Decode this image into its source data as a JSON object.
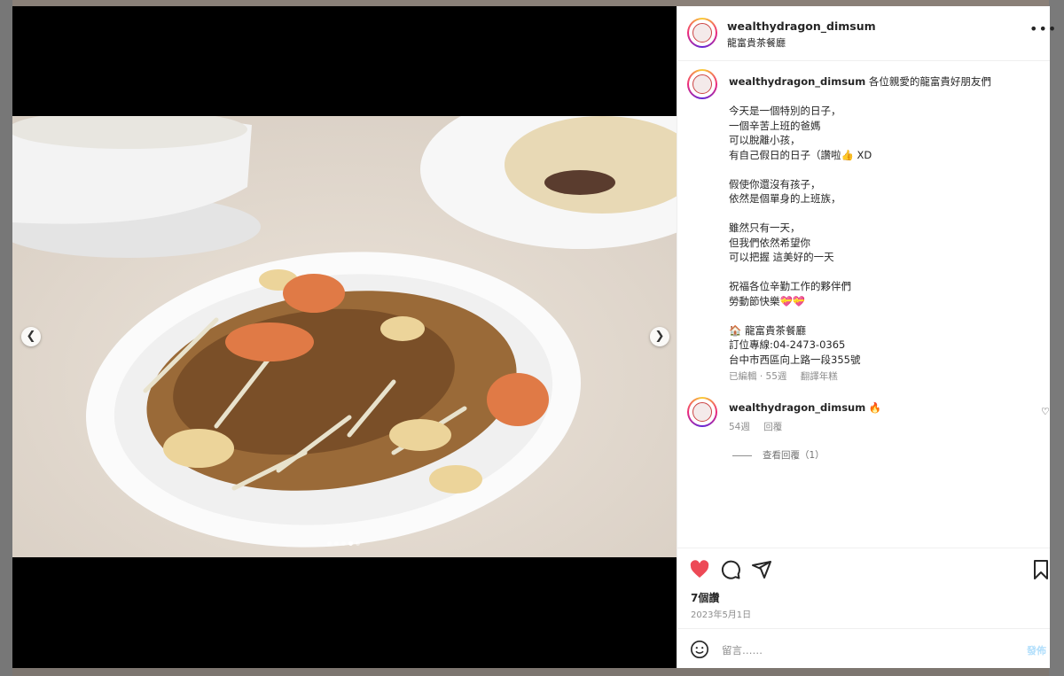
{
  "post": {
    "username": "wealthydragon_dimsum",
    "location": "龍富貴茶餐廳",
    "caption_lines": [
      "今天是一個特別的日子，",
      "一個辛苦上班的爸媽",
      "可以脫離小孩，",
      "有自己假日的日子（讚啦👍 XD",
      "",
      "假使你還沒有孩子，",
      "依然是個單身的上班族，",
      "",
      "雖然只有一天，",
      "但我們依然希望你",
      "可以把握 這美好的一天",
      "",
      "祝福各位辛勤工作的夥伴們",
      "勞動節快樂💝💝",
      "",
      "🏠 龍富貴茶餐廳",
      "訂位專線:04-2473-0365",
      "台中市西區向上路一段355號"
    ],
    "caption_first": "各位親愛的龍富貴好朋友們",
    "edited": "已編輯 · 55週",
    "translate": "翻譯年糕",
    "likes": "7個讚",
    "date": "2023年5月1日"
  },
  "comment": {
    "username": "wealthydragon_dimsum",
    "text": "🔥",
    "time": "54週",
    "reply": "回覆",
    "view_replies": "查看回覆（1）"
  },
  "input": {
    "placeholder": "留言……",
    "post_label": "發佈"
  },
  "colors": {
    "like_red": "#ed4956",
    "link_blue": "#b2dffc"
  },
  "carousel": {
    "total": 5,
    "active": 4
  }
}
